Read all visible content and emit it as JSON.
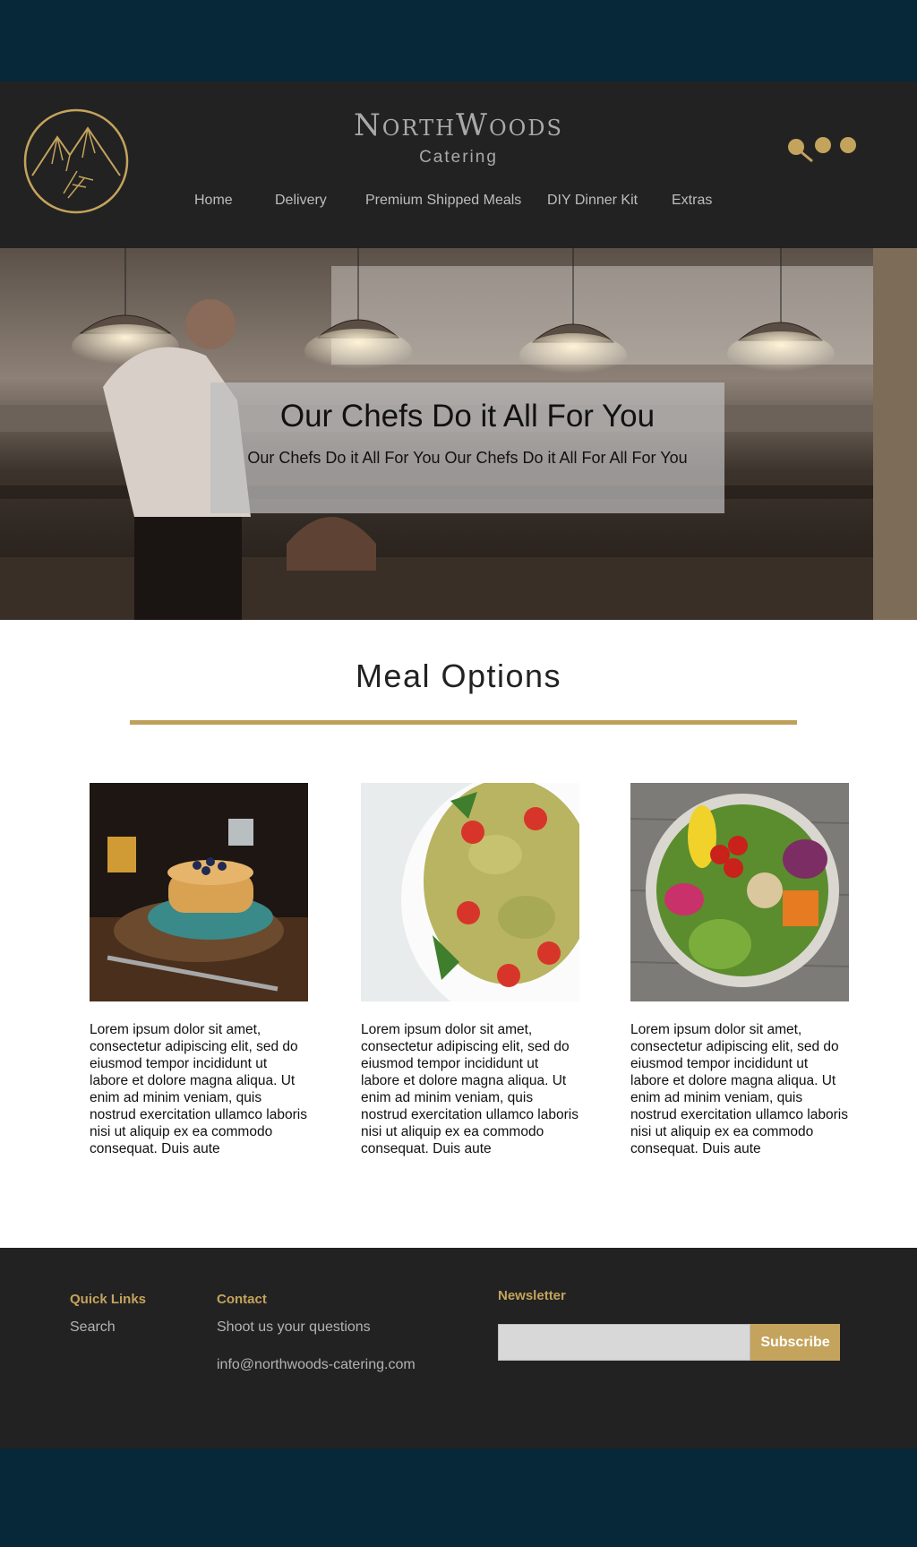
{
  "brand": {
    "name": "NorthWoods",
    "subtitle": "Catering"
  },
  "nav": [
    "Home",
    "Delivery",
    "Premium Shipped Meals",
    "DIY Dinner Kit",
    "Extras"
  ],
  "header_icons": [
    "search-icon",
    "dot-icon",
    "dot-icon"
  ],
  "hero": {
    "title": "Our Chefs Do it All For You",
    "subtitle": "Our Chefs Do it All For You Our Chefs Do it All For All For You"
  },
  "meal_options": {
    "title": "Meal Options",
    "cards": [
      {
        "image": "pancakes-image",
        "text": "Lorem ipsum dolor sit amet, consectetur adipiscing elit, sed do eiusmod tempor incididunt ut labore et dolore magna aliqua. Ut enim ad minim veniam, quis nostrud exercitation ullamco laboris nisi ut aliquip ex ea commodo consequat. Duis aute"
      },
      {
        "image": "pasta-salad-image",
        "text": "Lorem ipsum dolor sit amet, consectetur adipiscing elit, sed do eiusmod tempor incididunt ut labore et dolore magna aliqua. Ut enim ad minim veniam, quis nostrud exercitation ullamco laboris nisi ut aliquip ex ea commodo consequat. Duis aute"
      },
      {
        "image": "veggie-bowl-image",
        "text": "Lorem ipsum dolor sit amet, consectetur adipiscing elit, sed do eiusmod tempor incididunt ut labore et dolore magna aliqua. Ut enim ad minim veniam, quis nostrud exercitation ullamco laboris nisi ut aliquip ex ea commodo consequat. Duis aute"
      }
    ]
  },
  "footer": {
    "quick_links": {
      "heading": "Quick Links",
      "items": [
        "Search"
      ]
    },
    "contact": {
      "heading": "Contact",
      "line1": "Shoot us your questions",
      "email": "info@northwoods-catering.com"
    },
    "newsletter": {
      "heading": "Newsletter",
      "input_placeholder": "",
      "button_label": "Subscribe"
    }
  },
  "colors": {
    "accent": "#c4a35c",
    "header_bg": "#222222",
    "page_bg": "#062838"
  }
}
